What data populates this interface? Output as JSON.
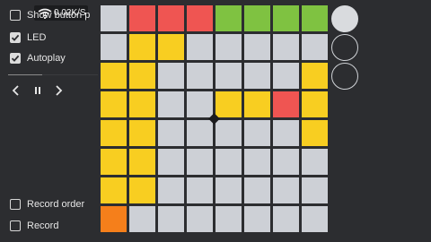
{
  "status_bar": {
    "speed": "0.02K/S",
    "wifi_icon": "wifi-icon"
  },
  "options": {
    "show_label": "Show button press",
    "show_checked": false,
    "led_label": "LED",
    "led_checked": true,
    "autoplay_label": "Autoplay",
    "autoplay_checked": true,
    "record_order_label": "Record order",
    "record_order_checked": false,
    "record_label": "Record",
    "record_checked": false
  },
  "playback": {
    "progress": 0.38,
    "icons": [
      "chevron-left-icon",
      "pause-icon",
      "chevron-right-icon"
    ]
  },
  "colors": {
    "empty": "#cdd0d6",
    "red": "#ef5552",
    "green": "#7fc241",
    "yellow": "#f8ce21",
    "orange": "#f57f1b",
    "background": "#2c2d30"
  },
  "pads": [
    [
      "empty",
      "red",
      "red",
      "red",
      "green",
      "green",
      "green",
      "green"
    ],
    [
      "empty",
      "yellow",
      "yellow",
      "empty",
      "empty",
      "empty",
      "empty",
      "empty"
    ],
    [
      "yellow",
      "yellow",
      "empty",
      "empty",
      "empty",
      "empty",
      "empty",
      "yellow"
    ],
    [
      "yellow",
      "yellow",
      "empty",
      "empty",
      "yellow",
      "yellow",
      "red",
      "yellow"
    ],
    [
      "yellow",
      "yellow",
      "empty",
      "empty",
      "empty",
      "empty",
      "empty",
      "yellow"
    ],
    [
      "yellow",
      "yellow",
      "empty",
      "empty",
      "empty",
      "empty",
      "empty",
      "empty"
    ],
    [
      "yellow",
      "yellow",
      "empty",
      "empty",
      "empty",
      "empty",
      "empty",
      "empty"
    ],
    [
      "orange",
      "empty",
      "empty",
      "empty",
      "empty",
      "empty",
      "empty",
      "empty"
    ]
  ],
  "side_buttons": [
    {
      "state": "filled"
    },
    {
      "state": "outline"
    },
    {
      "state": "outline"
    }
  ]
}
